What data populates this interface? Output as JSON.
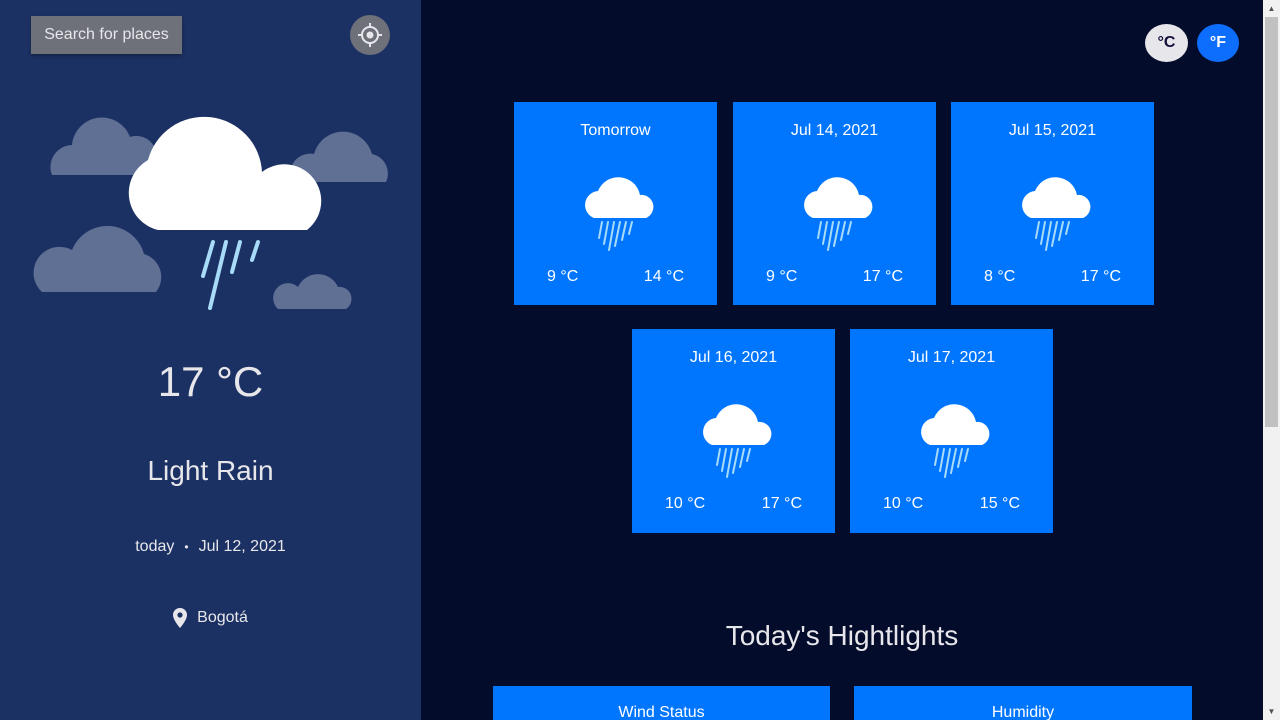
{
  "sidebar": {
    "search_label": "Search for places",
    "locate_icon": "crosshair-icon",
    "hero_icon": "light-rain-icon",
    "temperature": "17 °C",
    "condition": "Light Rain",
    "date_prefix": "today",
    "date_separator": "•",
    "date": "Jul 12, 2021",
    "location_icon": "map-pin-icon",
    "location": "Bogotá"
  },
  "units": {
    "celsius": "°C",
    "fahrenheit": "°F",
    "selected": "fahrenheit"
  },
  "forecast": [
    {
      "title": "Tomorrow",
      "icon": "light-rain-icon",
      "min": "9 °C",
      "max": "14 °C"
    },
    {
      "title": "Jul 14, 2021",
      "icon": "light-rain-icon",
      "min": "9 °C",
      "max": "17 °C"
    },
    {
      "title": "Jul 15, 2021",
      "icon": "light-rain-icon",
      "min": "8 °C",
      "max": "17 °C"
    },
    {
      "title": "Jul 16, 2021",
      "icon": "light-rain-icon",
      "min": "10 °C",
      "max": "17 °C"
    },
    {
      "title": "Jul 17, 2021",
      "icon": "light-rain-icon",
      "min": "10 °C",
      "max": "15 °C"
    }
  ],
  "highlights": {
    "title": "Today's Hightlights",
    "cards": [
      {
        "label": "Wind Status"
      },
      {
        "label": "Humidity"
      }
    ]
  },
  "colors": {
    "sidebar_bg": "#1c3163",
    "main_bg": "#040c2c",
    "card_bg": "#0076ff",
    "accent": "#0d6efd"
  }
}
